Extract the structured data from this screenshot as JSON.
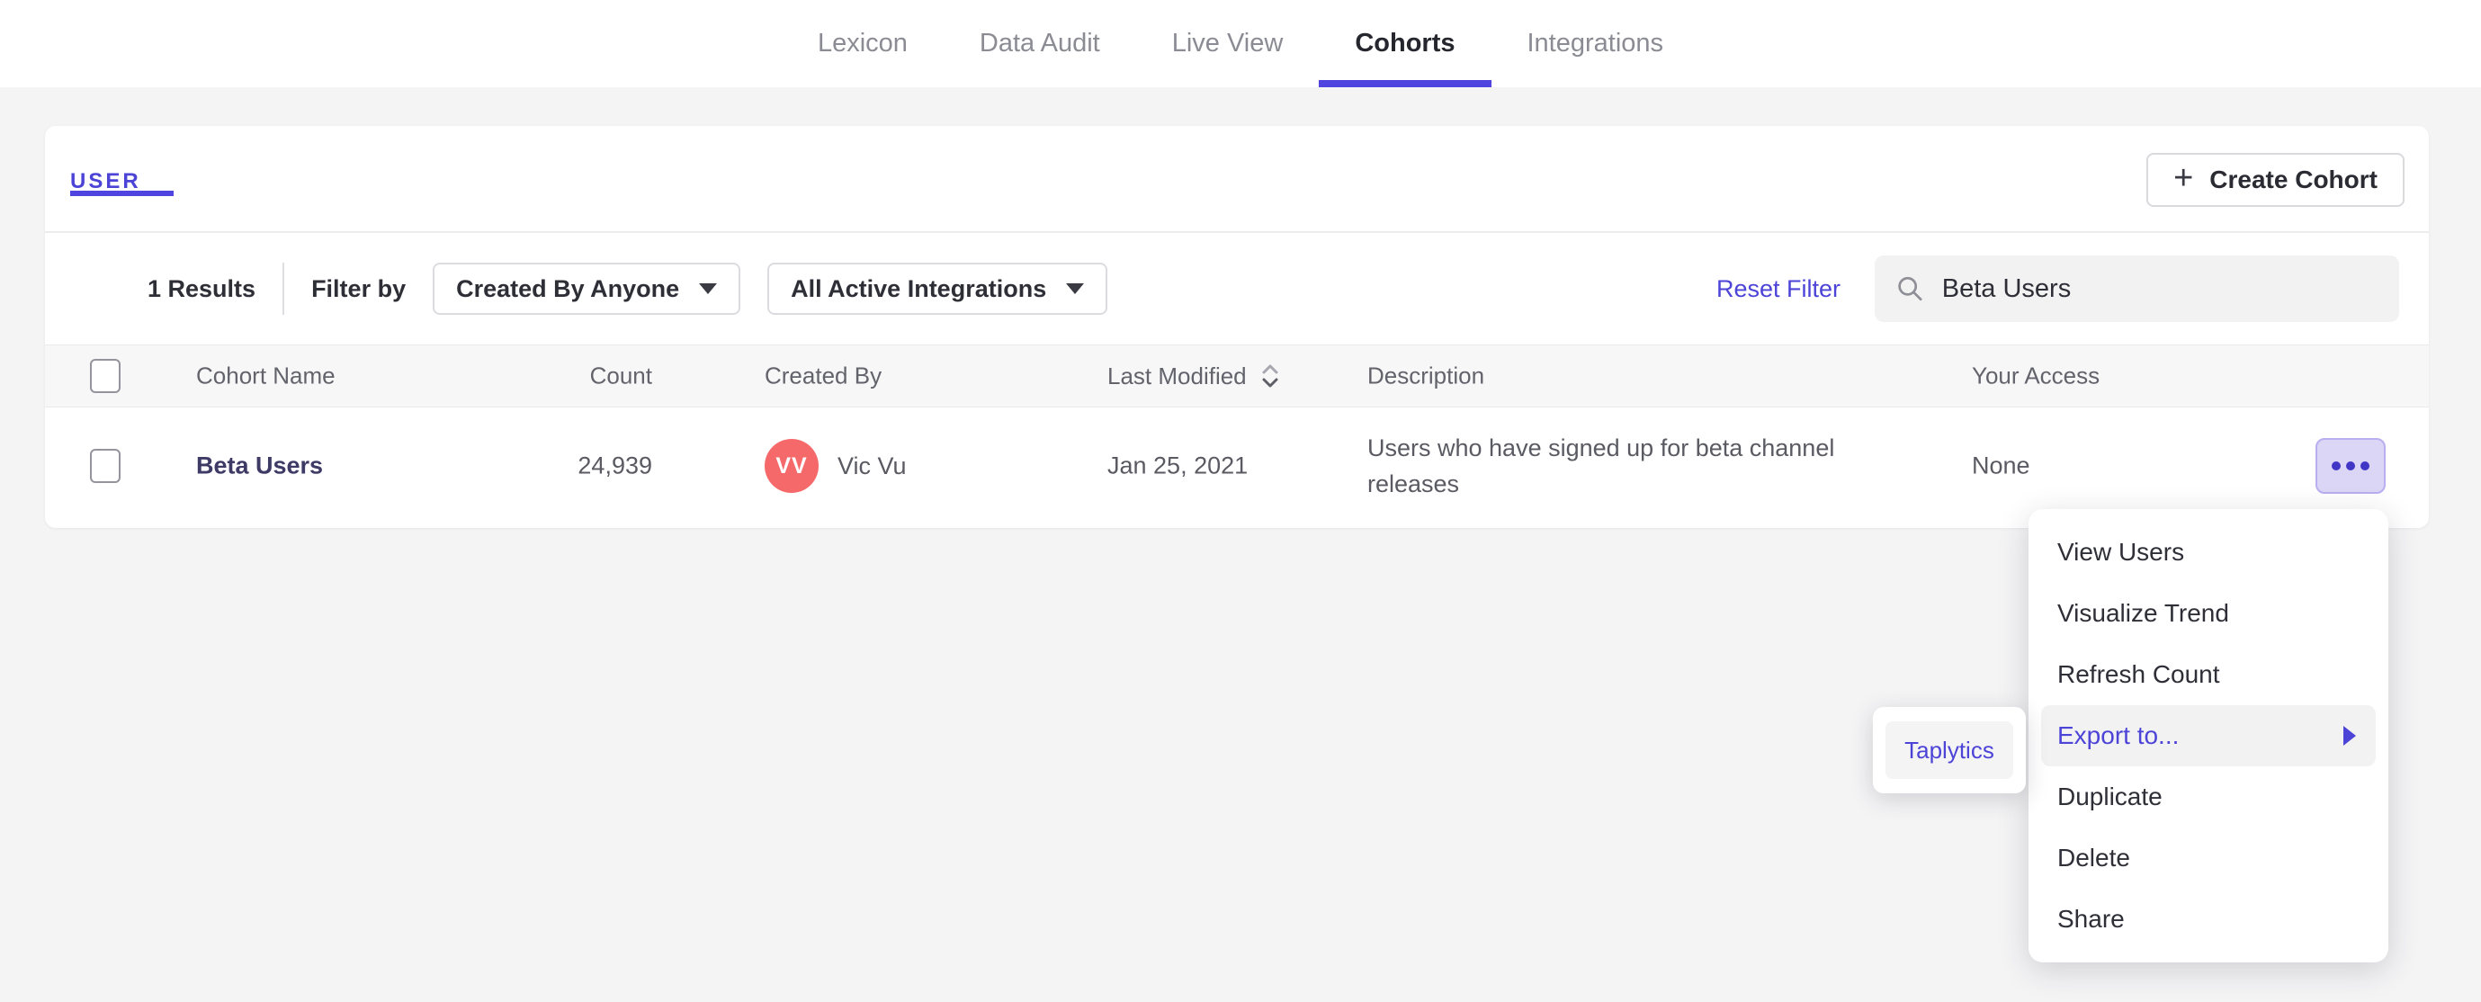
{
  "nav": {
    "tabs": [
      {
        "label": "Lexicon",
        "active": false
      },
      {
        "label": "Data Audit",
        "active": false
      },
      {
        "label": "Live View",
        "active": false
      },
      {
        "label": "Cohorts",
        "active": true
      },
      {
        "label": "Integrations",
        "active": false
      }
    ]
  },
  "icons": {
    "plus": "+"
  },
  "cohorts_panel": {
    "tab_label": "USER",
    "create_button_label": "Create Cohort",
    "filter_bar": {
      "results_count": "1 Results",
      "filter_by_label": "Filter by",
      "created_by_dropdown_value": "Created By Anyone",
      "integrations_dropdown_value": "All Active Integrations",
      "reset_filter_label": "Reset Filter",
      "search_value": "Beta Users"
    },
    "table": {
      "columns": {
        "name": "Cohort Name",
        "count": "Count",
        "created_by": "Created By",
        "last_modified": "Last Modified",
        "description": "Description",
        "your_access": "Your Access"
      },
      "sorted_column": "Last Modified",
      "rows": [
        {
          "name": "Beta Users",
          "count": "24,939",
          "created_by_initials": "VV",
          "created_by_name": "Vic Vu",
          "last_modified": "Jan 25, 2021",
          "description": "Users who have signed up for beta channel releases",
          "your_access": "None"
        }
      ]
    }
  },
  "context_menu": {
    "items": [
      {
        "label": "View Users"
      },
      {
        "label": "Visualize Trend"
      },
      {
        "label": "Refresh Count"
      },
      {
        "label": "Export to...",
        "highlighted": true,
        "has_submenu": true
      },
      {
        "label": "Duplicate"
      },
      {
        "label": "Delete"
      },
      {
        "label": "Share"
      }
    ]
  },
  "export_submenu": {
    "items": [
      {
        "label": "Taplytics"
      }
    ]
  },
  "colors": {
    "accent_purple": "#4f44e0",
    "link_purple": "#4c43d7",
    "avatar_red": "#f5696b",
    "more_button_bg": "#dbd5f6",
    "page_background": "#f4f4f5",
    "highlight_background": "#f2f2f3"
  }
}
